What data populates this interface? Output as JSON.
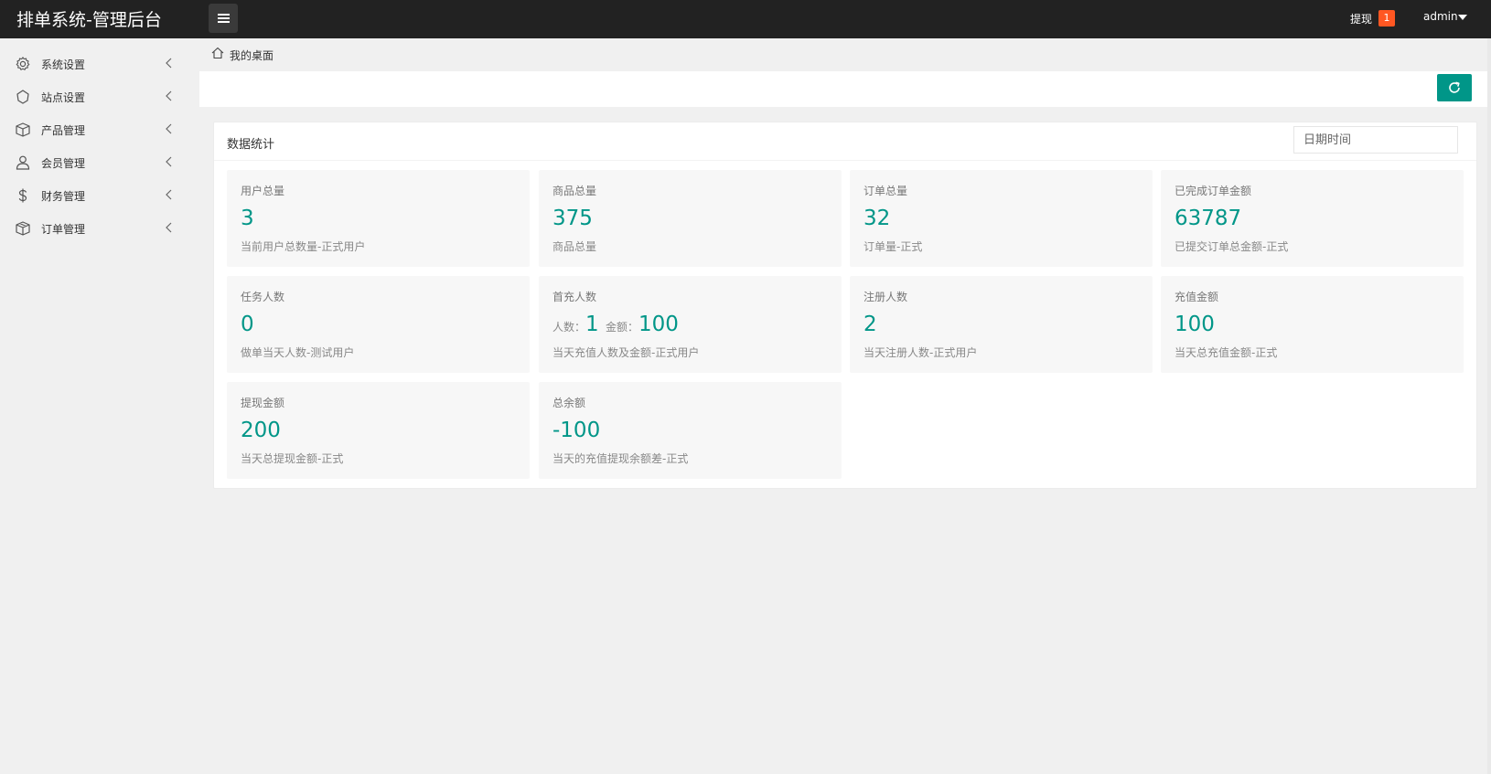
{
  "header": {
    "brand": "排单系统-管理后台",
    "withdraw_label": "提现",
    "withdraw_count": "1",
    "user_name": "admin"
  },
  "sidebar": {
    "items": [
      {
        "label": "系统设置",
        "icon": "gear-icon"
      },
      {
        "label": "站点设置",
        "icon": "site-icon"
      },
      {
        "label": "产品管理",
        "icon": "box-icon"
      },
      {
        "label": "会员管理",
        "icon": "user-icon"
      },
      {
        "label": "财务管理",
        "icon": "dollar-icon"
      },
      {
        "label": "订单管理",
        "icon": "package-icon"
      }
    ]
  },
  "breadcrumb": {
    "label": "我的桌面"
  },
  "panel": {
    "title": "数据统计",
    "date_placeholder": "日期时间"
  },
  "cards": [
    {
      "title": "用户总量",
      "value": "3",
      "desc": "当前用户总数量-正式用户"
    },
    {
      "title": "商品总量",
      "value": "375",
      "desc": "商品总量"
    },
    {
      "title": "订单总量",
      "value": "32",
      "desc": "订单量-正式"
    },
    {
      "title": "已完成订单金额",
      "value": "63787",
      "desc": "已提交订单总金额-正式"
    },
    {
      "title": "任务人数",
      "value": "0",
      "desc": "做单当天人数-测试用户"
    },
    {
      "title": "首充人数",
      "people_label": "人数：",
      "people_value": "1",
      "amount_label": "金额：",
      "amount_value": "100",
      "desc": "当天充值人数及金额-正式用户"
    },
    {
      "title": "注册人数",
      "value": "2",
      "desc": "当天注册人数-正式用户"
    },
    {
      "title": "充值金额",
      "value": "100",
      "desc": "当天总充值金额-正式"
    },
    {
      "title": "提现金额",
      "value": "200",
      "desc": "当天总提现金额-正式"
    },
    {
      "title": "总余额",
      "value": "-100",
      "desc": "当天的充值提现余额差-正式"
    }
  ],
  "colors": {
    "accent": "#009688",
    "header_bg": "#222222",
    "badge": "#ff5722"
  }
}
